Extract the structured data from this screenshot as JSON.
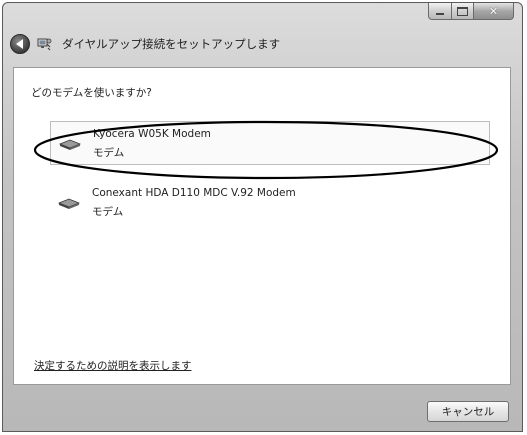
{
  "window": {
    "title": "ダイヤルアップ接続をセットアップします"
  },
  "content": {
    "question": "どのモデムを使いますか?",
    "modems": [
      {
        "name": "Kyocera W05K Modem",
        "type": "モデム",
        "selected": true
      },
      {
        "name": "Conexant HDA D110 MDC V.92 Modem",
        "type": "モデム",
        "selected": false
      }
    ],
    "help_link": "決定するための説明を表示します"
  },
  "footer": {
    "cancel_label": "キャンセル"
  },
  "icons": {
    "back": "back-arrow-icon",
    "title": "dialup-network-icon",
    "modem": "modem-icon"
  }
}
